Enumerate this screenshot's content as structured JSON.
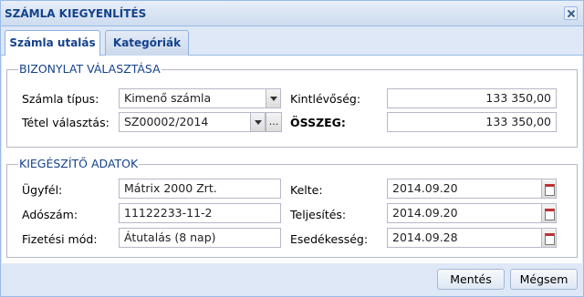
{
  "window": {
    "title": "SZÁMLA KIEGYENLÍTÉS"
  },
  "tabs": [
    {
      "label": "Számla utalás",
      "active": true
    },
    {
      "label": "Kategóriák",
      "active": false
    }
  ],
  "voucher_section": {
    "legend": "BIZONYLAT VÁLASZTÁSA",
    "invoice_type_label": "Számla típus:",
    "invoice_type_value": "Kimenő számla",
    "item_select_label": "Tétel választás:",
    "item_select_value": "SZ00002/2014",
    "browse_label": "...",
    "receivable_label": "Kintlévőség:",
    "receivable_value": "133 350,00",
    "total_label": "ÖSSZEG:",
    "total_value": "133 350,00"
  },
  "extra_section": {
    "legend": "KIEGÉSZÍTŐ ADATOK",
    "customer_label": "Ügyfél:",
    "customer_value": "Mátrix 2000 Zrt.",
    "tax_number_label": "Adószám:",
    "tax_number_value": "11122233-11-2",
    "payment_method_label": "Fizetési mód:",
    "payment_method_value": "Átutalás (8 nap)",
    "issue_date_label": "Kelte:",
    "issue_date_value": "2014.09.20",
    "fulfillment_label": "Teljesítés:",
    "fulfillment_value": "2014.09.20",
    "due_date_label": "Esedékesség:",
    "due_date_value": "2014.09.28"
  },
  "footer": {
    "save_label": "Mentés",
    "cancel_label": "Mégsem"
  },
  "icons": {
    "close": "close-icon",
    "dropdown": "chevron-down-icon",
    "date": "calendar-icon"
  },
  "colors": {
    "title_text": "#15428b",
    "window_border": "#99bbe8",
    "window_background": "#dfe8f6"
  }
}
